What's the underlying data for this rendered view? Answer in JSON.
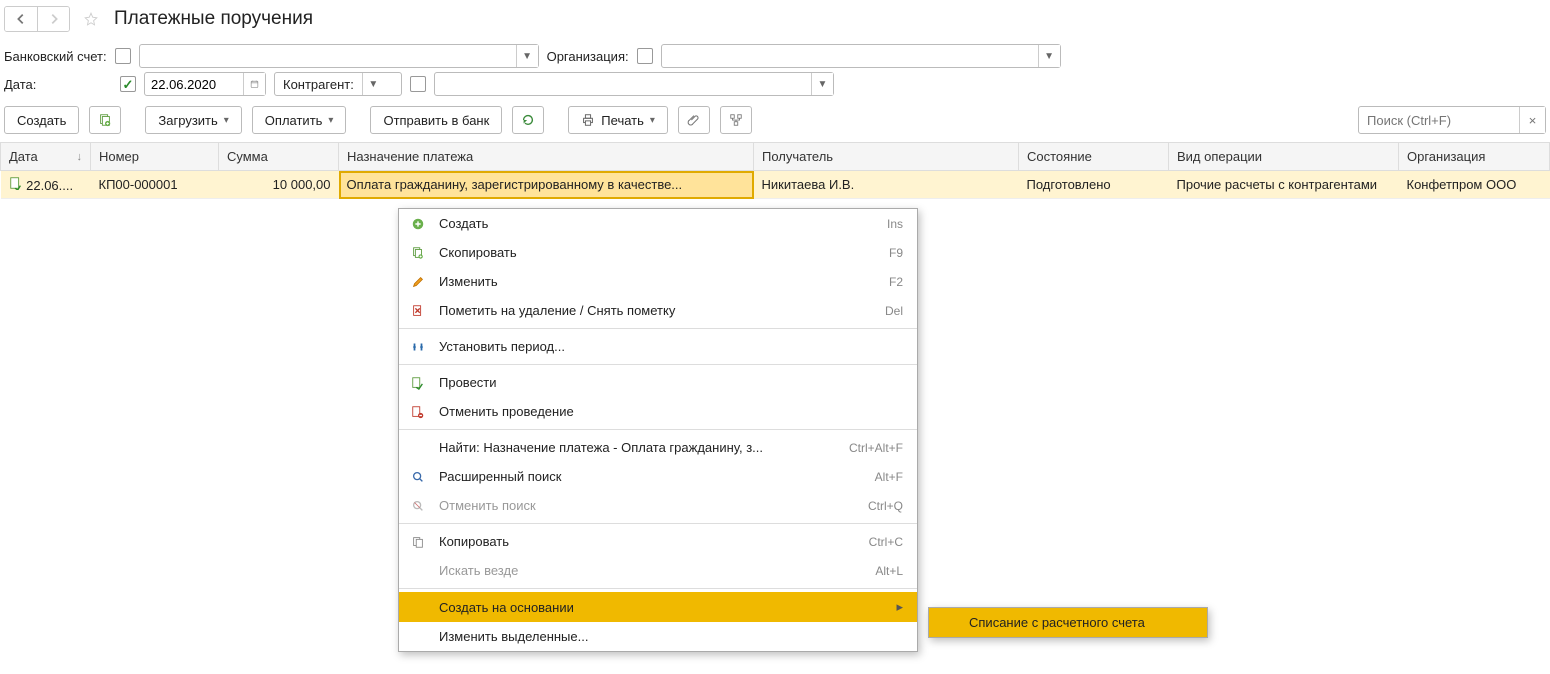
{
  "header": {
    "title": "Платежные поручения"
  },
  "filters": {
    "bank_account_label": "Банковский счет:",
    "org_label": "Организация:",
    "date_label": "Дата:",
    "date_value": "22.06.2020",
    "counterparty_label": "Контрагент:"
  },
  "toolbar": {
    "create": "Создать",
    "load": "Загрузить",
    "pay": "Оплатить",
    "send_bank": "Отправить в банк",
    "print": "Печать",
    "search_placeholder": "Поиск (Ctrl+F)"
  },
  "table": {
    "columns": {
      "date": "Дата",
      "number": "Номер",
      "sum": "Сумма",
      "purpose": "Назначение платежа",
      "recipient": "Получатель",
      "status": "Состояние",
      "operation_type": "Вид операции",
      "org": "Организация"
    },
    "rows": [
      {
        "date": "22.06....",
        "number": "КП00-000001",
        "sum": "10 000,00",
        "purpose": "Оплата гражданину, зарегистрированному в качестве...",
        "recipient": "Никитаева И.В.",
        "status": "Подготовлено",
        "operation_type": "Прочие расчеты с контрагентами",
        "org": "Конфетпром ООО"
      }
    ]
  },
  "context_menu": {
    "items": [
      {
        "label": "Создать",
        "shortcut": "Ins",
        "icon": "plus"
      },
      {
        "label": "Скопировать",
        "shortcut": "F9",
        "icon": "copydoc"
      },
      {
        "label": "Изменить",
        "shortcut": "F2",
        "icon": "pencil"
      },
      {
        "label": "Пометить на удаление / Снять пометку",
        "shortcut": "Del",
        "icon": "deletemark"
      },
      {
        "sep": true
      },
      {
        "label": "Установить период...",
        "icon": "period"
      },
      {
        "sep": true
      },
      {
        "label": "Провести",
        "icon": "post"
      },
      {
        "label": "Отменить проведение",
        "icon": "unpost"
      },
      {
        "sep": true
      },
      {
        "label": "Найти: Назначение платежа - Оплата гражданину, з...",
        "shortcut": "Ctrl+Alt+F"
      },
      {
        "label": "Расширенный поиск",
        "shortcut": "Alt+F",
        "icon": "search"
      },
      {
        "label": "Отменить поиск",
        "shortcut": "Ctrl+Q",
        "icon": "cancelsearch",
        "disabled": true
      },
      {
        "sep": true
      },
      {
        "label": "Копировать",
        "shortcut": "Ctrl+C",
        "icon": "copy"
      },
      {
        "label": "Искать везде",
        "shortcut": "Alt+L",
        "disabled": true
      },
      {
        "sep": true
      },
      {
        "label": "Создать на основании",
        "submenu": true,
        "highlight": true
      },
      {
        "label": "Изменить выделенные..."
      }
    ],
    "submenu_items": [
      {
        "label": "Списание с расчетного счета",
        "highlight": true
      }
    ]
  }
}
